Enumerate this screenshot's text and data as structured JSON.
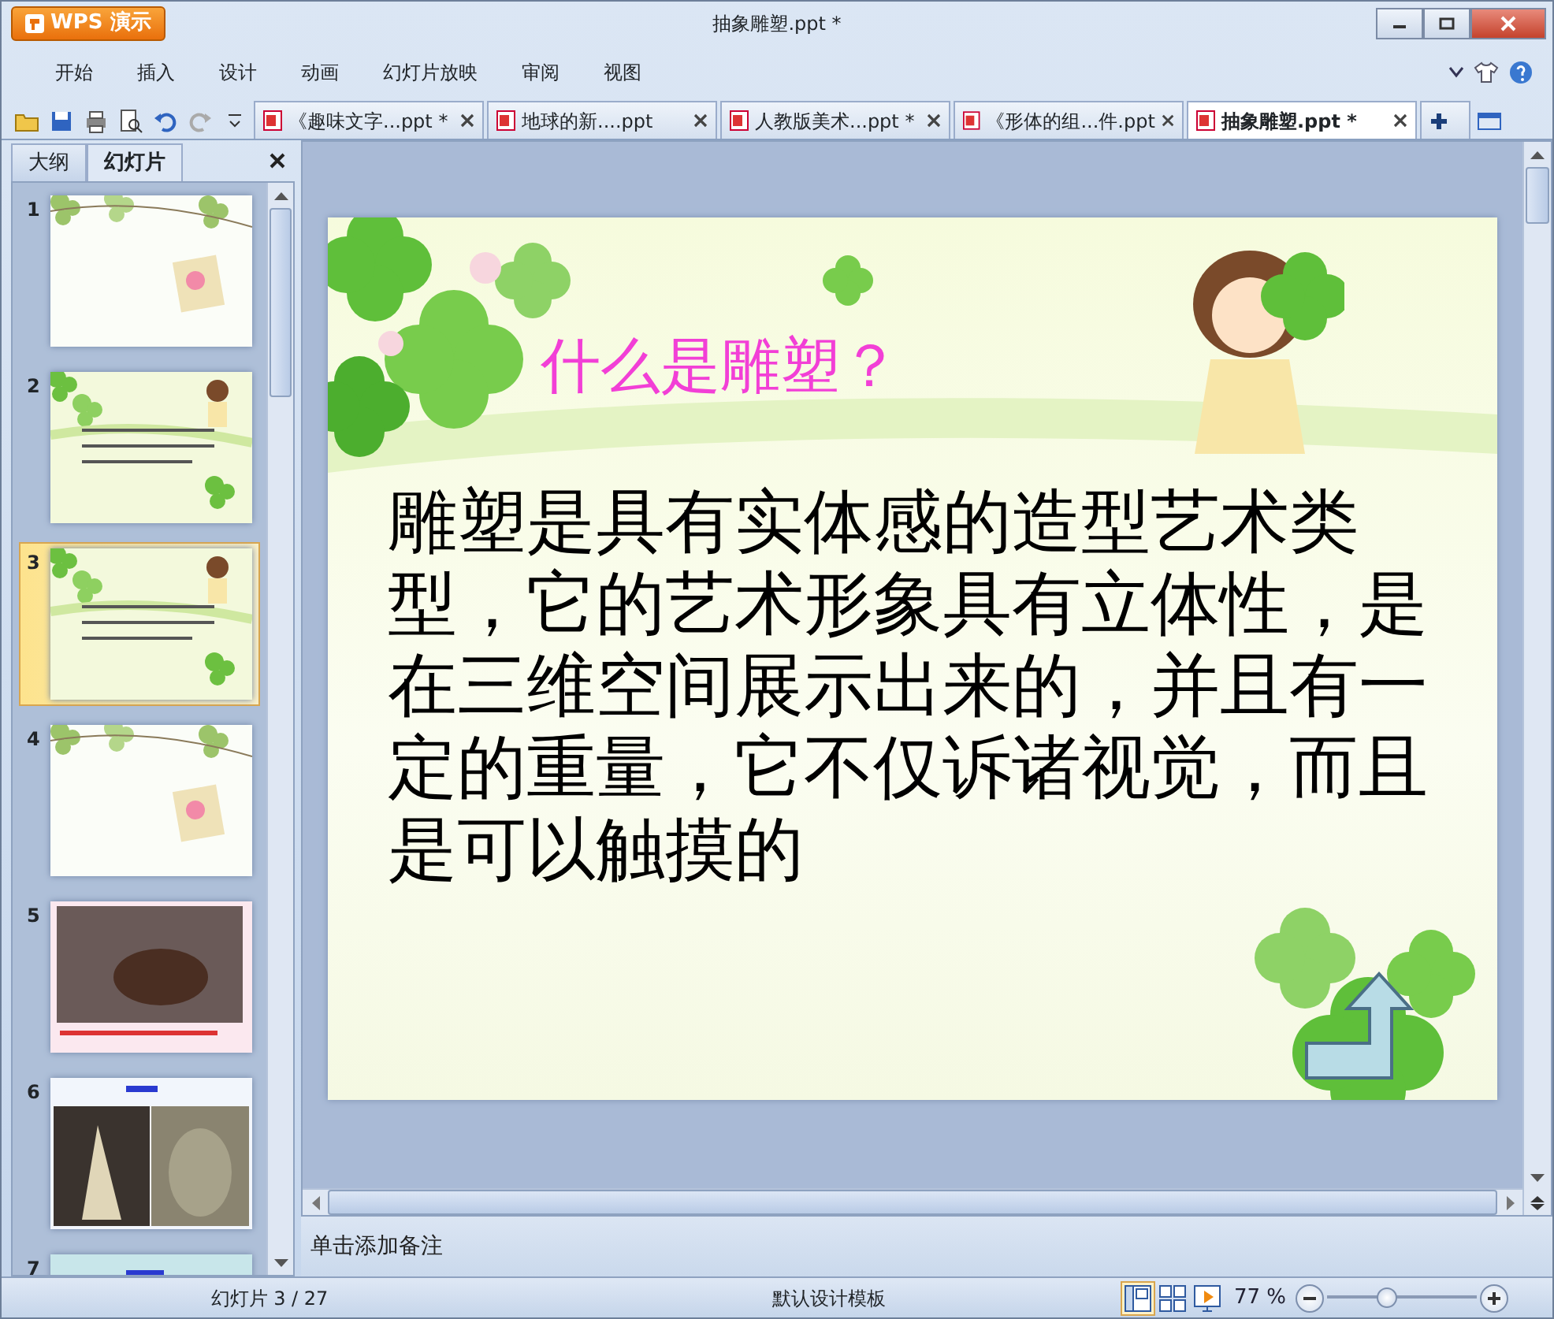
{
  "window": {
    "title": "抽象雕塑.ppt *",
    "app_button": "WPS 演示"
  },
  "menu": [
    {
      "label": "开始"
    },
    {
      "label": "插入"
    },
    {
      "label": "设计"
    },
    {
      "label": "动画"
    },
    {
      "label": "幻灯片放映"
    },
    {
      "label": "审阅"
    },
    {
      "label": "视图"
    }
  ],
  "doc_tabs": [
    {
      "label": "《趣味文字...ppt *",
      "selected": false
    },
    {
      "label": "地球的新....ppt",
      "selected": false
    },
    {
      "label": "人教版美术...ppt *",
      "selected": false
    },
    {
      "label": "《形体的组...件.ppt",
      "selected": false
    },
    {
      "label": "抽象雕塑.ppt *",
      "selected": true
    }
  ],
  "panel_tabs": [
    {
      "label": "大纲",
      "selected": false
    },
    {
      "label": "幻灯片",
      "selected": true
    }
  ],
  "thumbnails": [
    {
      "number": "1",
      "selected": false,
      "kind": "ivy"
    },
    {
      "number": "2",
      "selected": false,
      "kind": "clover"
    },
    {
      "number": "3",
      "selected": true,
      "kind": "clover"
    },
    {
      "number": "4",
      "selected": false,
      "kind": "ivy"
    },
    {
      "number": "5",
      "selected": false,
      "kind": "photo"
    },
    {
      "number": "6",
      "selected": false,
      "kind": "photos"
    },
    {
      "number": "7",
      "selected": false,
      "kind": "plain"
    }
  ],
  "slide": {
    "title": "什么是雕塑？",
    "body": "雕塑是具有实体感的造型艺术类型，它的艺术形象具有立体性，是在三维空间展示出来的，并且有一定的重量，它不仅诉诸视觉，而且是可以触摸的"
  },
  "notes": {
    "placeholder": "单击添加备注"
  },
  "status_bar": {
    "slide_count": "幻灯片 3 / 27",
    "template": "默认设计模板",
    "views": [
      {
        "kind": "normal",
        "selected": true
      },
      {
        "kind": "sorter",
        "selected": false
      },
      {
        "kind": "show",
        "selected": false
      }
    ],
    "zoom": "77 %",
    "zoom_slider": {
      "level": 0.4
    }
  }
}
